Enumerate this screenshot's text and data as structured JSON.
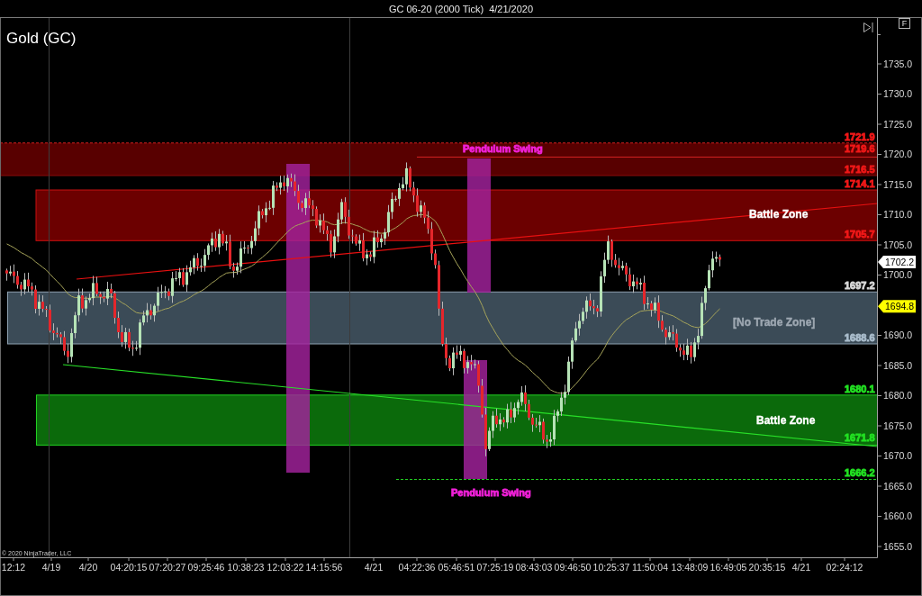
{
  "window": {
    "title": "GC 06-20 (2000 Tick)  4/21/2020"
  },
  "chart": {
    "instrument": "Gold (GC)",
    "panel_button": "F",
    "price_axis": {
      "ticks": [
        "1735.0",
        "1730.0",
        "1725.0",
        "1720.0",
        "1715.0",
        "1710.0",
        "1705.0",
        "1700.0",
        "1690.0",
        "1685.0",
        "1680.0",
        "1675.0",
        "1670.0",
        "1665.0",
        "1660.0",
        "1655.0"
      ]
    },
    "price_markers": [
      {
        "text": "1702.2",
        "color": "#ffffff"
      },
      {
        "text": "1694.8",
        "color": "#ffff00"
      }
    ],
    "level_labels": [
      {
        "text": "1721.9",
        "color": "#f01818"
      },
      {
        "text": "1719.6",
        "color": "#f01818"
      },
      {
        "text": "1716.5",
        "color": "#f01818"
      },
      {
        "text": "1714.1",
        "color": "#f01818"
      },
      {
        "text": "1705.7",
        "color": "#f01818"
      },
      {
        "text": "1697.2",
        "color": "#d8d8d8"
      },
      {
        "text": "1688.6",
        "color": "#a9bccb"
      },
      {
        "text": "1680.1",
        "color": "#22e022"
      },
      {
        "text": "1671.8",
        "color": "#22e022"
      },
      {
        "text": "1666.2",
        "color": "#22e022"
      }
    ],
    "annotations": [
      {
        "text": "Pendulum Swing",
        "color": "#f020d8"
      },
      {
        "text": "Battle Zone",
        "color": "#ffffff"
      },
      {
        "text": "[No Trade Zone]",
        "color": "#9ea8b2"
      },
      {
        "text": "Battle Zone",
        "color": "#ffffff"
      },
      {
        "text": "Pendulum Swing",
        "color": "#f020d8"
      }
    ],
    "time_axis": {
      "labels": [
        "12:12",
        "4/19",
        "4/20",
        "04:20:15",
        "07:20:27",
        "09:25:46",
        "10:38:23",
        "12:03:22",
        "14:15:56",
        "4/21",
        "04:22:36",
        "05:46:51",
        "07:25:19",
        "08:43:03",
        "09:46:50",
        "10:25:37",
        "11:50:04",
        "13:48:09",
        "16:49:05",
        "20:35:15",
        "4/21",
        "02:24:12"
      ]
    },
    "copyright": "© 2020 NinjaTrader, LLC"
  }
}
